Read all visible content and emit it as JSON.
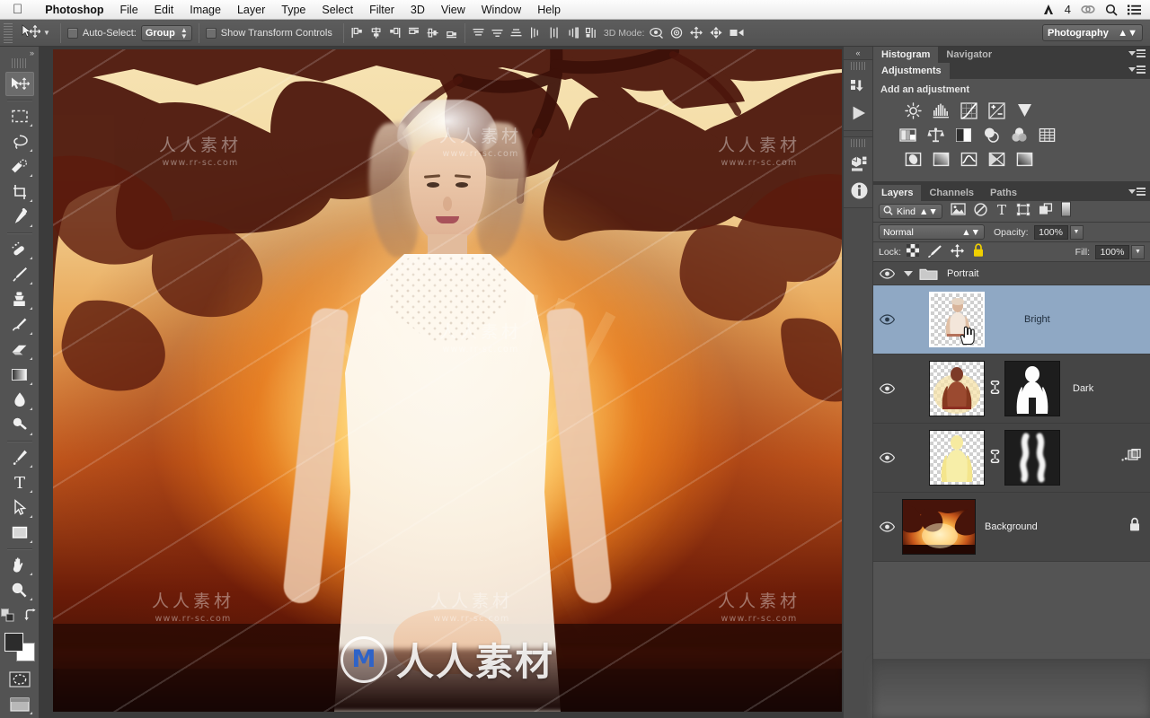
{
  "menubar": {
    "apple_icon": "apple-logo",
    "items": [
      {
        "label": "Photoshop",
        "bold": true
      },
      {
        "label": "File",
        "bold": false
      },
      {
        "label": "Edit",
        "bold": false
      },
      {
        "label": "Image",
        "bold": false
      },
      {
        "label": "Layer",
        "bold": false
      },
      {
        "label": "Type",
        "bold": false
      },
      {
        "label": "Select",
        "bold": false
      },
      {
        "label": "Filter",
        "bold": false
      },
      {
        "label": "3D",
        "bold": false
      },
      {
        "label": "View",
        "bold": false
      },
      {
        "label": "Window",
        "bold": false
      },
      {
        "label": "Help",
        "bold": false
      }
    ],
    "status_right": {
      "app_badge_label": "4",
      "app_badge_icon": "adobe-a-icon",
      "creative_cloud_icon": "creative-cloud-icon",
      "spotlight_icon": "search-icon",
      "list_icon": "notification-center-icon"
    }
  },
  "options_bar": {
    "tool_icon": "move-tool-icon",
    "tool_preset_caret": "chevron-down-icon",
    "auto_select_checked": false,
    "auto_select_label": "Auto-Select:",
    "auto_select_value": "Group",
    "show_transform_checked": false,
    "show_transform_label": "Show Transform Controls",
    "align_icons": [
      "align-left-edges-icon",
      "align-horizontal-centers-icon",
      "align-right-edges-icon",
      "align-top-edges-icon",
      "align-vertical-centers-icon",
      "align-bottom-edges-icon"
    ],
    "distribute_icons": [
      "distribute-top-edges-icon",
      "distribute-vertical-centers-icon",
      "distribute-bottom-edges-icon",
      "distribute-left-edges-icon",
      "distribute-horizontal-centers-icon",
      "distribute-right-edges-icon",
      "auto-align-layers-icon"
    ],
    "three_d_mode_label": "3D Mode:",
    "three_d_icons": [
      "orbit-3d-icon",
      "roll-3d-icon",
      "pan-3d-icon",
      "slide-3d-icon",
      "scale-3d-icon"
    ],
    "workspace_label": "Photography"
  },
  "tools_panel": {
    "collapse_icon": "double-chevron-right-icon",
    "tools": [
      {
        "name": "move-tool",
        "icon": "move-tool-icon",
        "active": true,
        "has_flyout": false
      },
      {
        "name": "rectangular-marquee-tool",
        "icon": "marquee-icon",
        "active": false,
        "has_flyout": true
      },
      {
        "name": "lasso-tool",
        "icon": "lasso-icon",
        "active": false,
        "has_flyout": true
      },
      {
        "name": "quick-selection-tool",
        "icon": "quick-select-icon",
        "active": false,
        "has_flyout": true
      },
      {
        "name": "crop-tool",
        "icon": "crop-icon",
        "active": false,
        "has_flyout": true
      },
      {
        "name": "eyedropper-tool",
        "icon": "eyedropper-icon",
        "active": false,
        "has_flyout": true
      },
      {
        "name": "spot-healing-brush-tool",
        "icon": "healing-brush-icon",
        "active": false,
        "has_flyout": true
      },
      {
        "name": "brush-tool",
        "icon": "brush-icon",
        "active": false,
        "has_flyout": true
      },
      {
        "name": "clone-stamp-tool",
        "icon": "clone-stamp-icon",
        "active": false,
        "has_flyout": true
      },
      {
        "name": "history-brush-tool",
        "icon": "history-brush-icon",
        "active": false,
        "has_flyout": true
      },
      {
        "name": "eraser-tool",
        "icon": "eraser-icon",
        "active": false,
        "has_flyout": true
      },
      {
        "name": "gradient-tool",
        "icon": "gradient-icon",
        "active": false,
        "has_flyout": true
      },
      {
        "name": "blur-tool",
        "icon": "blur-droplet-icon",
        "active": false,
        "has_flyout": true
      },
      {
        "name": "dodge-tool",
        "icon": "dodge-icon",
        "active": false,
        "has_flyout": true
      },
      {
        "name": "pen-tool",
        "icon": "pen-icon",
        "active": false,
        "has_flyout": true
      },
      {
        "name": "type-tool",
        "icon": "type-t-icon",
        "active": false,
        "has_flyout": true
      },
      {
        "name": "path-selection-tool",
        "icon": "path-arrow-icon",
        "active": false,
        "has_flyout": true
      },
      {
        "name": "rectangle-shape-tool",
        "icon": "rectangle-shape-icon",
        "active": false,
        "has_flyout": true
      },
      {
        "name": "hand-tool",
        "icon": "hand-icon",
        "active": false,
        "has_flyout": true
      },
      {
        "name": "zoom-tool",
        "icon": "zoom-magnifier-icon",
        "active": false,
        "has_flyout": true
      }
    ],
    "default_colors_icon": "default-colors-icon",
    "swap_colors_icon": "swap-colors-icon",
    "foreground_color": "#2c2c2c",
    "background_color": "#ffffff",
    "quick_mask_icon": "quick-mask-icon",
    "screen_mode_icon": "screen-mode-icon"
  },
  "dock": {
    "collapse_icon": "double-chevron-left-icon",
    "buttons": [
      {
        "name": "history-panel",
        "icon": "history-icon"
      },
      {
        "name": "actions-panel",
        "icon": "play-triangle-icon"
      },
      {
        "name": "3d-panel",
        "icon": "3d-cube-icon"
      },
      {
        "name": "info-panel",
        "icon": "info-circle-icon"
      }
    ]
  },
  "panels": {
    "histogram_group": {
      "tabs": [
        {
          "label": "Histogram",
          "active": true
        },
        {
          "label": "Navigator",
          "active": false
        }
      ],
      "menu_icon": "panel-menu-icon"
    },
    "adjustments": {
      "tab_label": "Adjustments",
      "menu_icon": "panel-menu-icon",
      "heading": "Add an adjustment",
      "rows": [
        [
          "brightness-contrast-icon",
          "levels-icon",
          "curves-icon",
          "exposure-icon",
          "vibrance-icon"
        ],
        [
          "hue-saturation-icon",
          "color-balance-icon",
          "black-white-icon",
          "photo-filter-icon",
          "channel-mixer-icon",
          "color-lookup-icon"
        ],
        [
          "invert-icon",
          "posterize-icon",
          "threshold-icon",
          "selective-color-icon",
          "gradient-map-icon"
        ]
      ]
    },
    "layers": {
      "tabs": [
        {
          "label": "Layers",
          "active": true
        },
        {
          "label": "Channels",
          "active": false
        },
        {
          "label": "Paths",
          "active": false
        }
      ],
      "menu_icon": "panel-menu-icon",
      "filter": {
        "search_icon": "search-icon",
        "kind_label": "Kind",
        "type_filters": [
          "filter-pixel-layers-icon",
          "filter-adjustment-layers-icon",
          "filter-type-layers-icon",
          "filter-shape-layers-icon",
          "filter-smart-object-icon"
        ],
        "toggle_icon": "filter-toggle-icon"
      },
      "blend_mode": "Normal",
      "opacity_label": "Opacity:",
      "opacity_value": "100%",
      "lock_label": "Lock:",
      "lock_icons": [
        "lock-transparent-pixels-icon",
        "lock-image-pixels-icon",
        "lock-position-icon",
        "lock-all-icon"
      ],
      "fill_label": "Fill:",
      "fill_value": "100%",
      "rows": [
        {
          "kind": "group",
          "name": "Portrait",
          "visible": true,
          "expanded": true,
          "eye_icon": "eye-icon",
          "disclosure_icon": "triangle-down-icon",
          "folder_icon": "folder-icon"
        },
        {
          "kind": "layer",
          "name": "Bright",
          "visible": true,
          "selected": true,
          "eye_icon": "eye-icon",
          "thumb": "portrait-transparent-thumb",
          "has_mask": false,
          "cursor_icon": "pointing-hand-cursor"
        },
        {
          "kind": "layer",
          "name": "Dark",
          "visible": true,
          "selected": false,
          "eye_icon": "eye-icon",
          "thumb": "portrait-warm-thumb",
          "has_mask": true,
          "link_icon": "link-mask-icon",
          "mask": "white-figure-silhouette-mask"
        },
        {
          "kind": "layer",
          "name": "",
          "visible": true,
          "selected": false,
          "eye_icon": "eye-icon",
          "thumb": "yellow-glow-figure-thumb",
          "has_mask": true,
          "link_icon": "link-mask-icon",
          "mask": "white-smoke-mask",
          "right_icon": "smart-filter-indicator-icon"
        },
        {
          "kind": "layer",
          "name": "Background",
          "visible": true,
          "selected": false,
          "eye_icon": "eye-icon",
          "thumb": "sunset-tree-background-thumb",
          "has_mask": false,
          "locked": true,
          "lock_icon": "lock-icon"
        }
      ]
    }
  },
  "canvas": {
    "document_description": "bride-portrait-sunset-composite",
    "watermarks": {
      "chinese_text": "人人素材",
      "site_text": "www.rr-sc.com",
      "logo_letter": "M"
    }
  }
}
